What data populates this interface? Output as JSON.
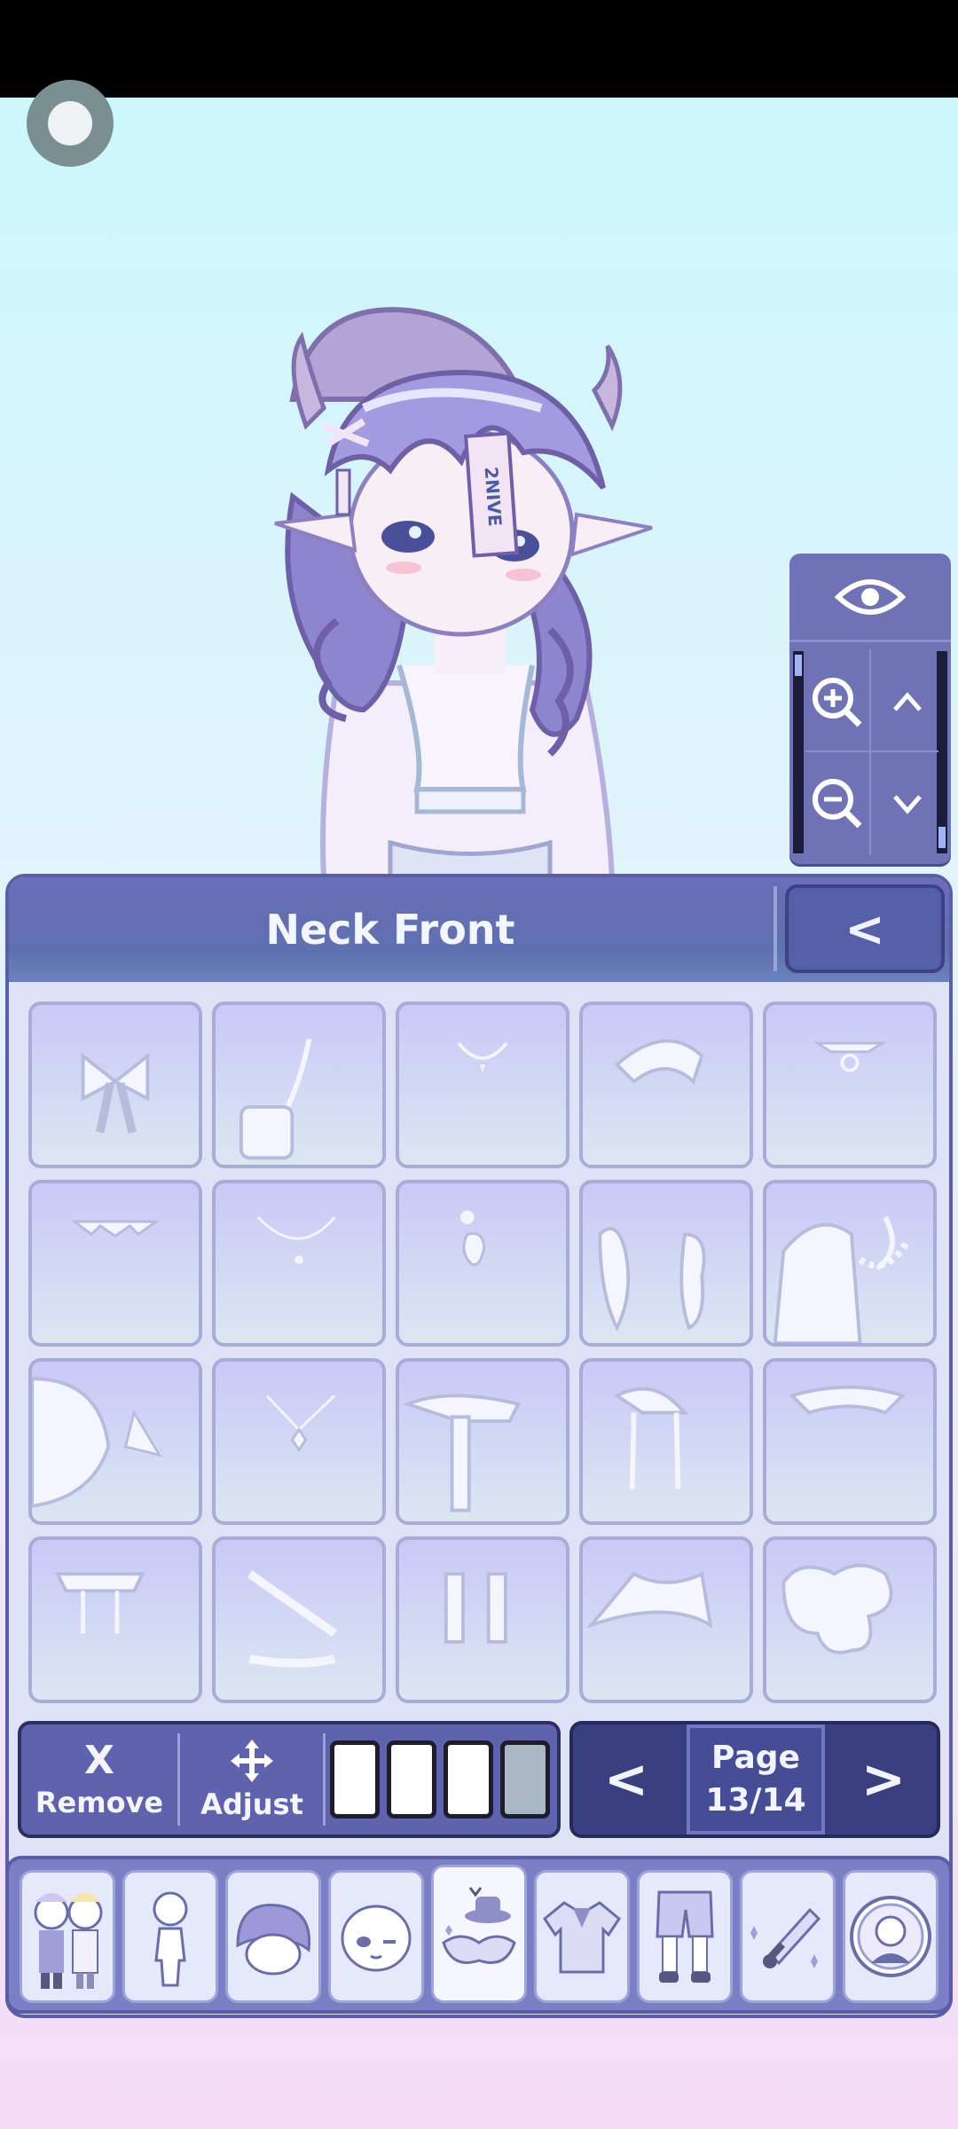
{
  "panel": {
    "title": "Neck Front",
    "back_label": "<"
  },
  "toolbar": {
    "remove_icon": "X",
    "remove_label": "Remove",
    "adjust_label": "Adjust",
    "slots_filled": [
      true,
      true,
      true,
      false
    ]
  },
  "pager": {
    "prev_label": "<",
    "next_label": ">",
    "page_label": "Page",
    "page_value": "13/14"
  },
  "character": {
    "forehead_note": "2NIVE"
  },
  "items": [
    {
      "icon": "bow-tie-icon"
    },
    {
      "icon": "pouch-strap-icon"
    },
    {
      "icon": "small-pendant-necklace-icon"
    },
    {
      "icon": "collar-scarf-icon"
    },
    {
      "icon": "ring-choker-icon"
    },
    {
      "icon": "spiked-choker-icon"
    },
    {
      "icon": "thin-chain-necklace-icon"
    },
    {
      "icon": "heart-charm-necklace-icon"
    },
    {
      "icon": "fur-boa-icon"
    },
    {
      "icon": "cape-with-pearls-icon"
    },
    {
      "icon": "feather-cape-icon"
    },
    {
      "icon": "diamond-pendant-icon"
    },
    {
      "icon": "long-tie-icon"
    },
    {
      "icon": "bow-ribbon-collar-icon"
    },
    {
      "icon": "folded-collar-icon"
    },
    {
      "icon": "collar-tabs-icon"
    },
    {
      "icon": "belt-strap-icon"
    },
    {
      "icon": "buckle-straps-icon"
    },
    {
      "icon": "sailor-collar-icon"
    },
    {
      "icon": "cloud-ruffle-icon"
    }
  ],
  "categories": [
    {
      "icon": "presets-couple-icon"
    },
    {
      "icon": "body-icon"
    },
    {
      "icon": "hair-icon"
    },
    {
      "icon": "face-icon"
    },
    {
      "icon": "accessories-mask-hat-icon",
      "active": true
    },
    {
      "icon": "shirt-icon"
    },
    {
      "icon": "pants-shoes-icon"
    },
    {
      "icon": "props-sword-icon"
    },
    {
      "icon": "profile-badge-icon"
    }
  ],
  "colors": {
    "panel_accent": "#5f63ad",
    "tile_fill": "#d3d9f4",
    "hair": "#8b7ec8"
  }
}
